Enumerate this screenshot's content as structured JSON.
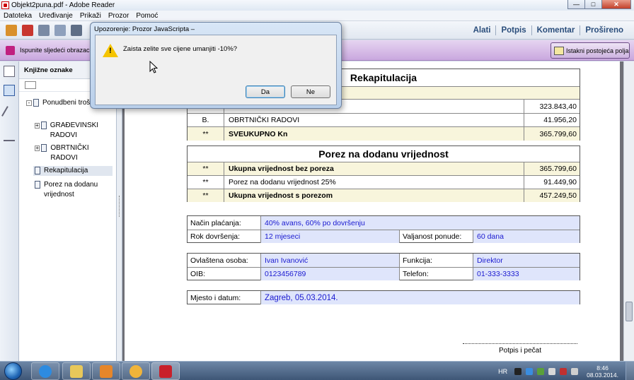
{
  "window": {
    "title": "Objekt2puna.pdf - Adobe Reader",
    "min_glyph": "—",
    "max_glyph": "□",
    "close_glyph": "✕"
  },
  "menu": [
    "Datoteka",
    "Uređivanje",
    "Prikaži",
    "Prozor",
    "Pomoć"
  ],
  "toolbar_right": [
    "Alati",
    "Potpis",
    "Komentar",
    "Prošireno"
  ],
  "formbar": {
    "message": "Ispunite sljedeći obrazac. P",
    "highlight_button": "Istakni postojeća polja"
  },
  "bookmarks": {
    "header": "Knjižne oznake",
    "items": [
      {
        "label": "Ponudbeni troškovnik",
        "expander": "-"
      },
      {
        "label": "GRAĐEVINSKI RADOVI",
        "expander": "+"
      },
      {
        "label": "OBRTNIČKI RADOVI",
        "expander": "+"
      },
      {
        "label": "Rekapitulacija",
        "expander": ""
      },
      {
        "label": "Porez na dodanu vrijednost",
        "expander": ""
      }
    ]
  },
  "recap": {
    "title": "Rekapitulacija",
    "rows": [
      {
        "code": "B.",
        "label": "OBRTNIČKI RADOVI",
        "value": "41.956,20",
        "bold": false
      },
      {
        "code": "**",
        "label": "SVEUKUPNO Kn",
        "value": "365.799,60",
        "bold": true
      }
    ],
    "partial_value": "323.843,40"
  },
  "vat": {
    "title": "Porez na dodanu vrijednost",
    "rows": [
      {
        "code": "**",
        "label": "Ukupna vrijednost bez poreza",
        "value": "365.799,60",
        "bold": true
      },
      {
        "code": "**",
        "label": "Porez na dodanu vrijednost 25%",
        "value": "91.449,90",
        "bold": false
      },
      {
        "code": "**",
        "label": "Ukupna vrijednost s porezom",
        "value": "457.249,50",
        "bold": true
      }
    ]
  },
  "payment": {
    "nacin_label": "Način plaćanja:",
    "nacin_value": "40% avans, 60% po dovršenju",
    "rok_label": "Rok dovršenja:",
    "rok_value": "12 mjeseci",
    "valjanost_label": "Valjanost ponude:",
    "valjanost_value": "60 dana"
  },
  "person": {
    "osoba_label": "Ovlaštena osoba:",
    "osoba_value": "Ivan Ivanović",
    "funkcija_label": "Funkcija:",
    "funkcija_value": "Direktor",
    "oib_label": "OIB:",
    "oib_value": "0123456789",
    "telefon_label": "Telefon:",
    "telefon_value": "01-333-3333"
  },
  "place": {
    "label": "Mjesto i datum:",
    "value": "Zagreb, 05.03.2014."
  },
  "signature": {
    "label": "Potpis i pečat"
  },
  "dialog": {
    "title": "Upozorenje: Prozor JavaScripta –",
    "message": "Zaista zelite sve cijene umanjiti -10%?",
    "yes": "Da",
    "no": "Ne"
  },
  "tray": {
    "language": "HR",
    "time": "8:46",
    "date": "08.03.2014."
  },
  "colors": {
    "form_field_bg": "#dfe5fb",
    "form_field_text": "#1a1ad0",
    "formbar": "#c9a8de",
    "accent": "#2a4d7b"
  }
}
